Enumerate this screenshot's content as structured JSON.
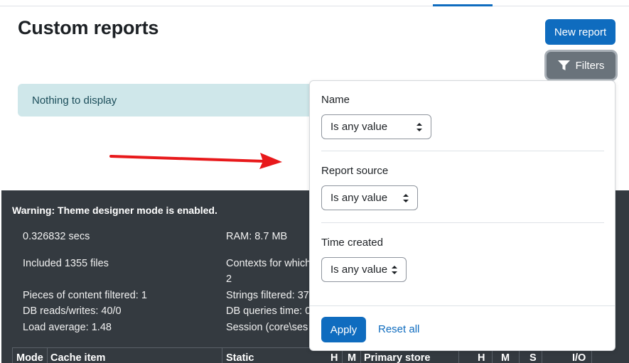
{
  "header": {
    "title": "Custom reports",
    "new_report_label": "New report",
    "filters_label": "Filters"
  },
  "main": {
    "empty_message": "Nothing to display"
  },
  "filters": {
    "fields": [
      {
        "label": "Name",
        "value": "Is any value"
      },
      {
        "label": "Report source",
        "value": "Is any value"
      },
      {
        "label": "Time created",
        "value": "Is any value"
      }
    ],
    "apply_label": "Apply",
    "reset_label": "Reset all"
  },
  "footer": {
    "warning": "Warning: Theme designer mode is enabled.",
    "time": "0.326832 secs",
    "ram": "RAM: 8.7 MB",
    "included_files": "Included 1355 files",
    "contexts": "Contexts for which",
    "contexts_count": "2",
    "pieces_filtered": "Pieces of content filtered: 1",
    "strings_filtered": "Strings filtered: 37",
    "db_reads": "DB reads/writes: 40/0",
    "db_queries": "DB queries time: 0",
    "load_average": "Load average: 1.48",
    "session": "Session (core\\ses",
    "table_headers": [
      "Mode",
      "Cache item",
      "Static",
      "H",
      "M",
      "Primary store",
      "H",
      "M",
      "S",
      "I/O"
    ]
  },
  "colors": {
    "primary": "#0f6cbf",
    "secondary": "#6a737b",
    "info_bg": "#cfe7ea",
    "footer_bg": "#343a40",
    "annotation_arrow": "#e8191b"
  }
}
